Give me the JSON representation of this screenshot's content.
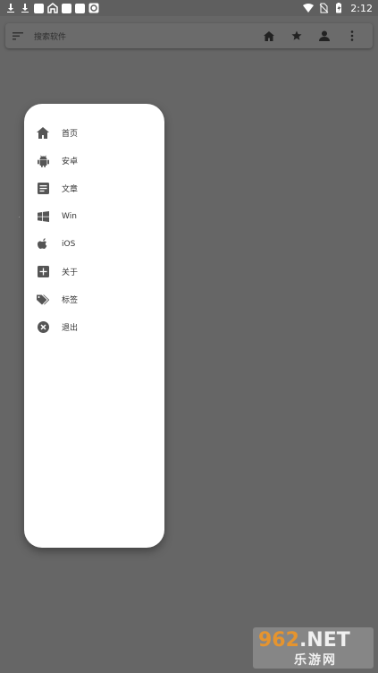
{
  "status_bar": {
    "time": "2:12",
    "left_icons": [
      "download-icon",
      "download-icon",
      "app-icon",
      "app-icon",
      "app-icon",
      "app-icon",
      "app-icon"
    ],
    "right_icons": [
      "wifi-icon",
      "no-sim-icon",
      "battery-icon"
    ]
  },
  "search": {
    "placeholder": "搜索软件"
  },
  "toolbar": {
    "actions": [
      "home-icon",
      "star-icon",
      "person-icon",
      "more-icon"
    ]
  },
  "menu": {
    "items": [
      {
        "label": "首页",
        "icon": "home-icon"
      },
      {
        "label": "安卓",
        "icon": "android-icon"
      },
      {
        "label": "文章",
        "icon": "article-icon"
      },
      {
        "label": "Win",
        "icon": "windows-icon"
      },
      {
        "label": "iOS",
        "icon": "apple-icon"
      },
      {
        "label": "关于",
        "icon": "add-box-icon"
      },
      {
        "label": "标签",
        "icon": "tag-icon"
      },
      {
        "label": "退出",
        "icon": "close-circle-icon"
      }
    ]
  },
  "watermark": {
    "brand_number": "962",
    "brand_suffix": ".NET",
    "brand_text": "乐游网"
  },
  "colors": {
    "overlay": "#666666",
    "drawer_bg": "#ffffff",
    "icon": "#555555",
    "watermark_accent": "#f39a2a"
  }
}
